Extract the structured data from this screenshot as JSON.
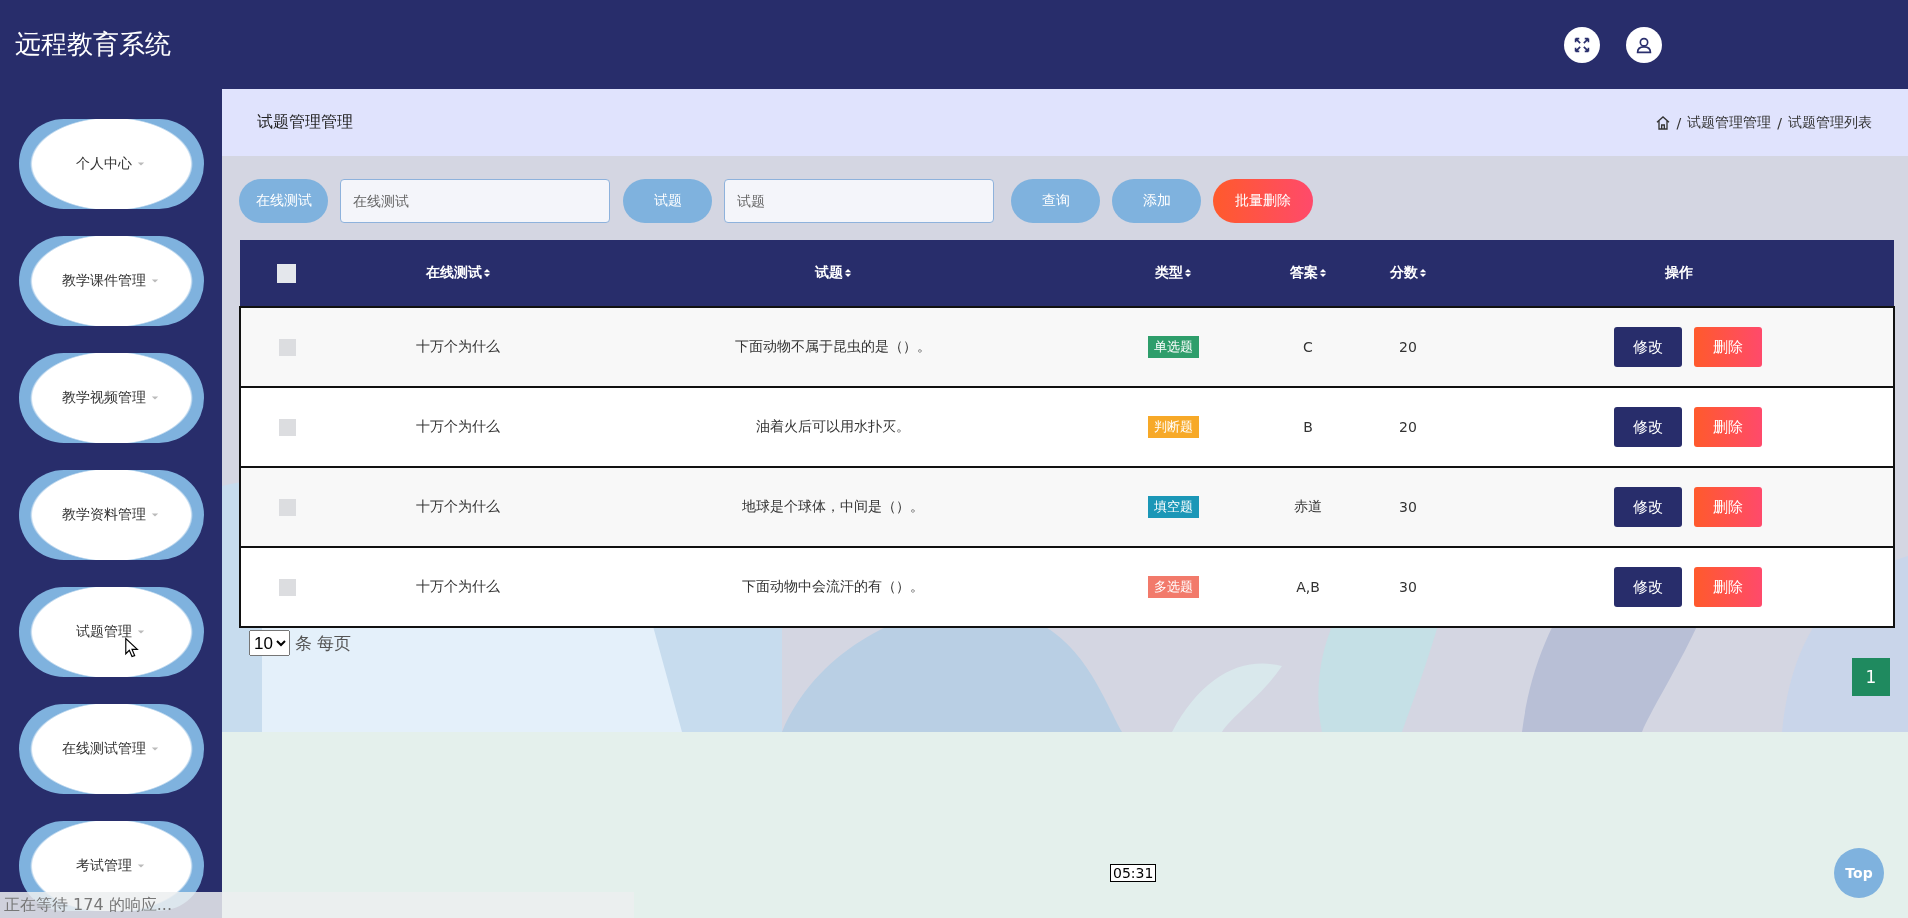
{
  "header": {
    "title": "远程教育系统"
  },
  "sidebar": {
    "items": [
      {
        "label": "个人中心",
        "hovered": false
      },
      {
        "label": "教学课件管理",
        "hovered": false
      },
      {
        "label": "教学视频管理",
        "hovered": false
      },
      {
        "label": "教学资料管理",
        "hovered": false
      },
      {
        "label": "试题管理",
        "hovered": true
      },
      {
        "label": "在线测试管理",
        "hovered": false
      },
      {
        "label": "考试管理",
        "hovered": false
      }
    ]
  },
  "breadcrumb": {
    "title": "试题管理管理",
    "separator": "/",
    "crumbs": [
      "试题管理管理",
      "试题管理列表"
    ]
  },
  "search": {
    "fields": [
      {
        "label": "在线测试",
        "placeholder": "在线测试"
      },
      {
        "label": "试题",
        "placeholder": "试题"
      }
    ],
    "buttons": [
      {
        "label": "查询",
        "kind": "primary"
      },
      {
        "label": "添加",
        "kind": "primary"
      },
      {
        "label": "批量删除",
        "kind": "danger"
      }
    ]
  },
  "table": {
    "select_all_checked": false,
    "columns": [
      {
        "label": "在线测试",
        "sortable": true
      },
      {
        "label": "试题",
        "sortable": true
      },
      {
        "label": "类型",
        "sortable": true
      },
      {
        "label": "答案",
        "sortable": true
      },
      {
        "label": "分数",
        "sortable": true
      },
      {
        "label": "操作",
        "sortable": false
      }
    ],
    "rows": [
      {
        "checked": false,
        "test": "十万个为什么",
        "question": "下面动物不属于昆虫的是（）。",
        "type": "单选题",
        "color": "#2e9e6b",
        "answer": "C",
        "score": "20",
        "actions": [
          "修改",
          "删除"
        ]
      },
      {
        "checked": false,
        "test": "十万个为什么",
        "question": "油着火后可以用水扑灭。",
        "type": "判断题",
        "color": "#f7a928",
        "answer": "B",
        "score": "20",
        "actions": [
          "修改",
          "删除"
        ]
      },
      {
        "checked": false,
        "test": "十万个为什么",
        "question": "地球是个球体，中间是（）。",
        "type": "填空题",
        "color": "#1b97b7",
        "answer": "赤道",
        "score": "30",
        "actions": [
          "修改",
          "删除"
        ]
      },
      {
        "checked": false,
        "test": "十万个为什么",
        "question": "下面动物中会流汗的有（）。",
        "type": "多选题",
        "color": "#f27a6b",
        "answer": "A,B",
        "score": "30",
        "actions": [
          "修改",
          "删除"
        ]
      }
    ]
  },
  "pagination": {
    "page_size": "10",
    "page_size_suffix": "条 每页",
    "pages": [
      {
        "label": "1",
        "selected": true
      }
    ]
  },
  "top_button": "Top",
  "video_tooltip": "05:31",
  "status_bar": "正在等待 174 的响应..."
}
